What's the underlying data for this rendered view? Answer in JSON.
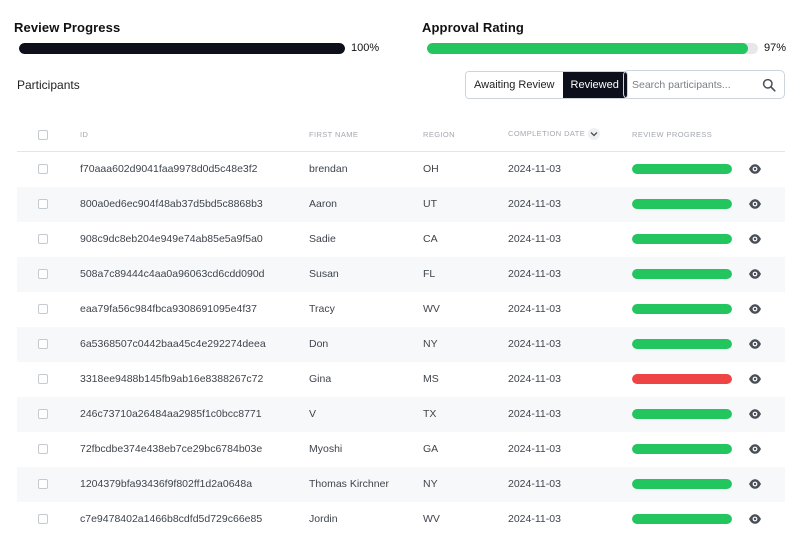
{
  "review_progress": {
    "label": "Review Progress",
    "value_text": "100%",
    "fraction": 1.0
  },
  "approval_rating": {
    "label": "Approval Rating",
    "value_text": "97%",
    "fraction": 0.97
  },
  "section": {
    "title": "Participants"
  },
  "filter": {
    "options": [
      "Awaiting Review",
      "Reviewed"
    ],
    "active": "Reviewed"
  },
  "search": {
    "placeholder": "Search participants...",
    "value": ""
  },
  "table": {
    "headers": {
      "id": "ID",
      "first_name": "FIRST NAME",
      "region": "REGION",
      "completion_date": "COMPLETION DATE",
      "review_progress": "REVIEW PROGRESS"
    },
    "rows": [
      {
        "id": "f70aaa602d9041faa9978d0d5c48e3f2",
        "first_name": "brendan",
        "region": "OH",
        "completion_date": "2024-11-03",
        "progress_fraction": 1.0,
        "status_color": "#22c55e"
      },
      {
        "id": "800a0ed6ec904f48ab37d5bd5c8868b3",
        "first_name": "Aaron",
        "region": "UT",
        "completion_date": "2024-11-03",
        "progress_fraction": 1.0,
        "status_color": "#22c55e"
      },
      {
        "id": "908c9dc8eb204e949e74ab85e5a9f5a0",
        "first_name": "Sadie",
        "region": "CA",
        "completion_date": "2024-11-03",
        "progress_fraction": 1.0,
        "status_color": "#22c55e"
      },
      {
        "id": "508a7c89444c4aa0a96063cd6cdd090d",
        "first_name": "Susan",
        "region": "FL",
        "completion_date": "2024-11-03",
        "progress_fraction": 1.0,
        "status_color": "#22c55e"
      },
      {
        "id": "eaa79fa56c984fbca9308691095e4f37",
        "first_name": "Tracy",
        "region": "WV",
        "completion_date": "2024-11-03",
        "progress_fraction": 1.0,
        "status_color": "#22c55e"
      },
      {
        "id": "6a5368507c0442baa45c4e292274deea",
        "first_name": "Don",
        "region": "NY",
        "completion_date": "2024-11-03",
        "progress_fraction": 1.0,
        "status_color": "#22c55e"
      },
      {
        "id": "3318ee9488b145fb9ab16e8388267c72",
        "first_name": "Gina",
        "region": "MS",
        "completion_date": "2024-11-03",
        "progress_fraction": 1.0,
        "status_color": "#ef4444"
      },
      {
        "id": "246c73710a26484aa2985f1c0bcc8771",
        "first_name": "V",
        "region": "TX",
        "completion_date": "2024-11-03",
        "progress_fraction": 1.0,
        "status_color": "#22c55e"
      },
      {
        "id": "72fbcdbe374e438eb7ce29bc6784b03e",
        "first_name": "Myoshi",
        "region": "GA",
        "completion_date": "2024-11-03",
        "progress_fraction": 1.0,
        "status_color": "#22c55e"
      },
      {
        "id": "1204379bfa93436f9f802ff1d2a0648a",
        "first_name": "Thomas Kirchner",
        "region": "NY",
        "completion_date": "2024-11-03",
        "progress_fraction": 1.0,
        "status_color": "#22c55e"
      },
      {
        "id": "c7e9478402a1466b8cdfd5d729c66e85",
        "first_name": "Jordin",
        "region": "WV",
        "completion_date": "2024-11-03",
        "progress_fraction": 1.0,
        "status_color": "#22c55e"
      }
    ]
  },
  "icons": {
    "search": "search-icon",
    "view": "eye-icon",
    "sort": "chevron-down-icon"
  },
  "colors": {
    "dark": "#0d0f1a",
    "success": "#22c55e",
    "danger": "#ef4444"
  }
}
